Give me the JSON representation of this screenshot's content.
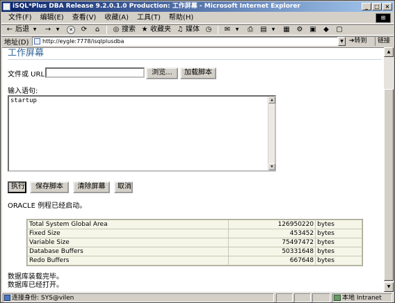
{
  "window": {
    "title": "iSQL*Plus DBA Release 9.2.0.1.0 Production: 工作屏幕 - Microsoft Internet Explorer",
    "min_glyph": "_",
    "max_glyph": "□",
    "close_glyph": "×"
  },
  "menubar": {
    "items": [
      "文件(F)",
      "编辑(E)",
      "查看(V)",
      "收藏(A)",
      "工具(T)",
      "帮助(H)"
    ]
  },
  "toolbar": {
    "back_label": "后退",
    "search_label": "搜索",
    "favorites_label": "收藏夹",
    "media_label": "媒体"
  },
  "addressbar": {
    "label": "地址(D)",
    "url": "http://eygle:7778/isqlplusdba",
    "go_label": "转到",
    "links_label": "链接"
  },
  "page": {
    "title": "工作屏幕",
    "file_label": "文件或 URL:",
    "url_value": "",
    "browse_label": "浏览...",
    "load_script_label": "加载脚本",
    "statement_label": "输入语句:",
    "statement_text": "startup",
    "execute_label": "执行",
    "save_script_label": "保存脚本",
    "clear_screen_label": "清除屏幕",
    "cancel_label": "取消",
    "instance_started_msg": "ORACLE 例程已经启动。",
    "db_mounted_msg": "数据库装载完毕。",
    "db_opened_msg": "数据库已经打开。"
  },
  "results": {
    "rows": [
      {
        "name": "Total System Global Area",
        "value": "126950220",
        "unit": "bytes"
      },
      {
        "name": "Fixed Size",
        "value": "453452",
        "unit": "bytes"
      },
      {
        "name": "Variable Size",
        "value": "75497472",
        "unit": "bytes"
      },
      {
        "name": "Database Buffers",
        "value": "50331648",
        "unit": "bytes"
      },
      {
        "name": "Redo Buffers",
        "value": "667648",
        "unit": "bytes"
      }
    ]
  },
  "statusbar": {
    "identity_text": "连接身份: SYS@vilen",
    "zone_text": "本地 Intranet"
  },
  "colors": {
    "title_active": "#0a246a",
    "page_title": "#336699",
    "table_cell_bg": "#f5f5e8"
  }
}
